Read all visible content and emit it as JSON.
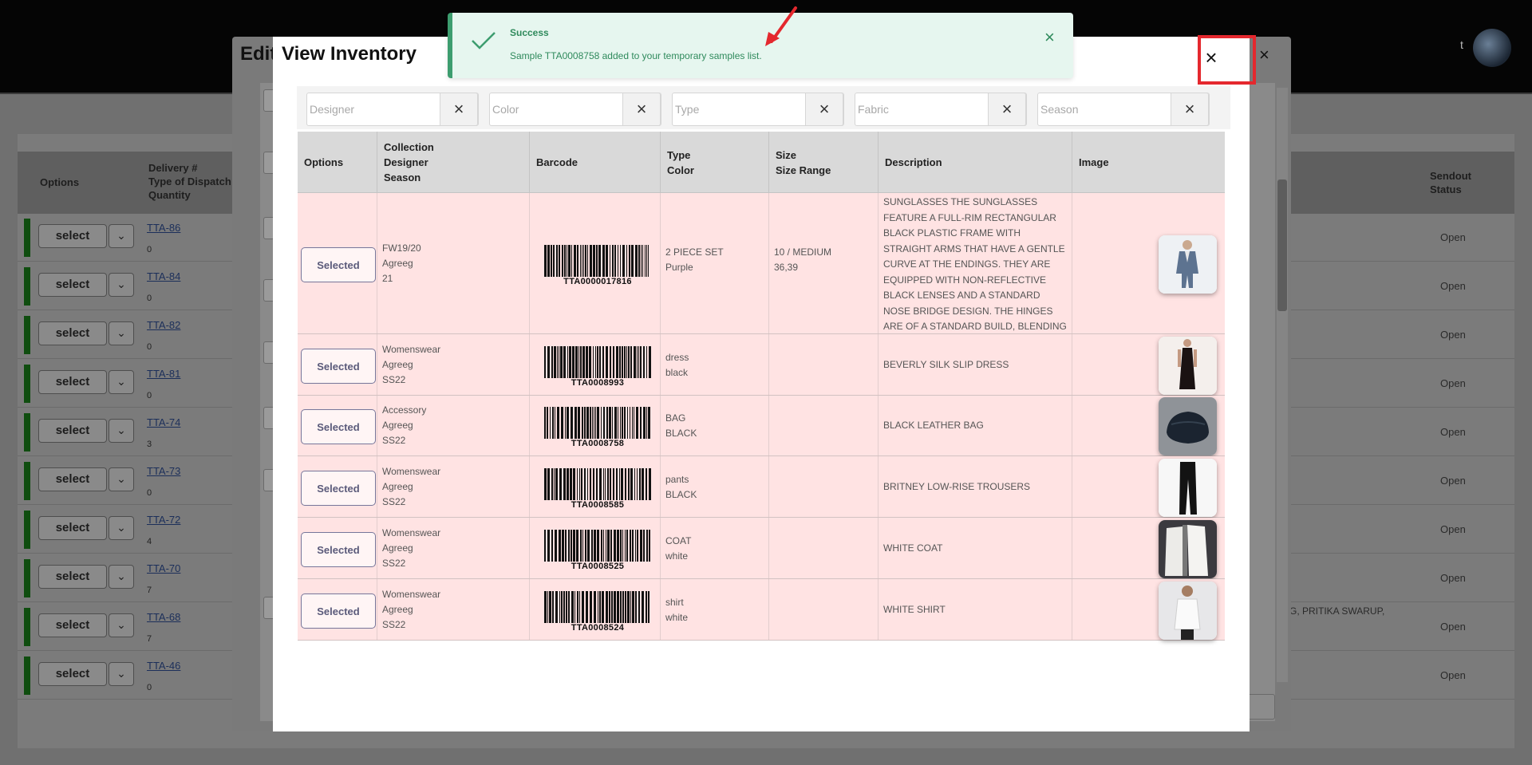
{
  "app": {
    "avatar_initial": "t"
  },
  "background_table": {
    "headers": {
      "options": "Options",
      "delivery": [
        "Delivery #",
        "Type of Dispatch",
        "Quantity"
      ],
      "status": [
        "Sendout",
        "Status"
      ]
    },
    "select_label": "select",
    "rows": [
      {
        "delivery": "TTA-86",
        "quantity": "0",
        "status": "Open"
      },
      {
        "delivery": "TTA-84",
        "quantity": "0",
        "status": "Open"
      },
      {
        "delivery": "TTA-82",
        "quantity": "0",
        "status": "Open"
      },
      {
        "delivery": "TTA-81",
        "quantity": "0",
        "status": "Open"
      },
      {
        "delivery": "TTA-74",
        "quantity": "3",
        "status": "Open"
      },
      {
        "delivery": "TTA-73",
        "quantity": "0",
        "status": "Open"
      },
      {
        "delivery": "TTA-72",
        "quantity": "4",
        "status": "Open"
      },
      {
        "delivery": "TTA-70",
        "quantity": "7",
        "status": "Open"
      },
      {
        "delivery": "TTA-68",
        "quantity": "7",
        "status": "Open"
      },
      {
        "delivery": "TTA-46",
        "quantity": "0",
        "status": "Open"
      }
    ],
    "note": "G, PRITIKA SWARUP,"
  },
  "edit_modal": {
    "title": "Edit",
    "close": "×"
  },
  "inventory_modal": {
    "title": "View Inventory",
    "close": "×",
    "filters": [
      {
        "placeholder": "Designer",
        "clear": "×"
      },
      {
        "placeholder": "Color",
        "clear": "×"
      },
      {
        "placeholder": "Type",
        "clear": "×"
      },
      {
        "placeholder": "Fabric",
        "clear": "×"
      },
      {
        "placeholder": "Season",
        "clear": "×"
      }
    ],
    "headers": {
      "options": "Options",
      "collection": [
        "Collection",
        "Designer",
        "Season"
      ],
      "barcode": "Barcode",
      "type": [
        "Type",
        "Color"
      ],
      "size": [
        "Size",
        "Size Range"
      ],
      "description": "Description",
      "image": "Image"
    },
    "rows": [
      {
        "option": "Selected",
        "collection": "FW19/20",
        "designer": "Agreeg",
        "season": "21",
        "barcode": "TTA0000017816",
        "type": "2 PIECE SET",
        "color": "Purple",
        "size": "10 / MEDIUM",
        "size_range": "36,39",
        "description": "SUNGLASSES THE SUNGLASSES FEATURE A FULL-RIM RECTANGULAR BLACK PLASTIC FRAME WITH STRAIGHT ARMS THAT HAVE A GENTLE CURVE AT THE ENDINGS. THEY ARE EQUIPPED WITH NON-REFLECTIVE BLACK LENSES AND A STANDARD NOSE BRIDGE DESIGN. THE HINGES ARE OF A STANDARD BUILD, BLENDING SEAMLESSLY WITH THE OVERALL SILHOUETTE OF THE GLASSES.",
        "image_icon": "suit-photo-icon"
      },
      {
        "option": "Selected",
        "collection": "Womenswear",
        "designer": "Agreeg",
        "season": "SS22",
        "barcode": "TTA0008993",
        "type": "dress",
        "color": "black",
        "size": "",
        "size_range": "",
        "description": "BEVERLY SILK SLIP DRESS",
        "image_icon": "dress-photo-icon"
      },
      {
        "option": "Selected",
        "collection": "Accessory",
        "designer": "Agreeg",
        "season": "SS22",
        "barcode": "TTA0008758",
        "type": "BAG",
        "color": "BLACK",
        "size": "",
        "size_range": "",
        "description": "BLACK LEATHER BAG",
        "image_icon": "bag-photo-icon"
      },
      {
        "option": "Selected",
        "collection": "Womenswear",
        "designer": "Agreeg",
        "season": "SS22",
        "barcode": "TTA0008585",
        "type": "pants",
        "color": "BLACK",
        "size": "",
        "size_range": "",
        "description": "BRITNEY LOW-RISE TROUSERS",
        "image_icon": "trousers-photo-icon"
      },
      {
        "option": "Selected",
        "collection": "Womenswear",
        "designer": "Agreeg",
        "season": "SS22",
        "barcode": "TTA0008525",
        "type": "COAT",
        "color": "white",
        "size": "",
        "size_range": "",
        "description": "WHITE COAT",
        "image_icon": "coat-photo-icon"
      },
      {
        "option": "Selected",
        "collection": "Womenswear",
        "designer": "Agreeg",
        "season": "SS22",
        "barcode": "TTA0008524",
        "type": "shirt",
        "color": "white",
        "size": "",
        "size_range": "",
        "description": "WHITE SHIRT",
        "image_icon": "shirt-photo-icon"
      }
    ]
  },
  "toast": {
    "title": "Success",
    "message": "Sample TTA0008758 added to your temporary samples list.",
    "close": "×",
    "accent": "#3d9d6f"
  },
  "annotations": {
    "highlight_color": "#e4282e",
    "arrow_color": "#e4282e"
  }
}
